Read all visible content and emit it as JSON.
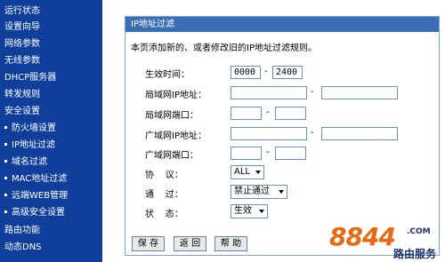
{
  "sidebar": {
    "items": [
      {
        "label": "运行状态",
        "sub": false
      },
      {
        "label": "设置向导",
        "sub": false
      },
      {
        "label": "网络参数",
        "sub": false
      },
      {
        "label": "无线参数",
        "sub": false
      },
      {
        "label": "DHCP服务器",
        "sub": false
      },
      {
        "label": "转发规则",
        "sub": false
      },
      {
        "label": "安全设置",
        "sub": false
      },
      {
        "label": "防火墙设置",
        "sub": true
      },
      {
        "label": "IP地址过滤",
        "sub": true
      },
      {
        "label": "域名过滤",
        "sub": true
      },
      {
        "label": "MAC地址过滤",
        "sub": true
      },
      {
        "label": "远端WEB管理",
        "sub": true
      },
      {
        "label": "高级安全设置",
        "sub": true
      },
      {
        "label": "路由功能",
        "sub": false
      },
      {
        "label": "动态DNS",
        "sub": false
      }
    ]
  },
  "panel": {
    "title": "IP地址过滤",
    "description": "本页添加新的、或者修改旧的IP地址过滤规则。"
  },
  "form": {
    "effective_time_label": "生效时间：",
    "time_start": "0000",
    "time_end": "2400",
    "lan_ip_label": "局域网IP地址：",
    "lan_ip_start": "",
    "lan_ip_end": "",
    "lan_port_label": "局域网端口：",
    "lan_port_start": "",
    "lan_port_end": "",
    "wan_ip_label": "广域网IP地址：",
    "wan_ip_start": "",
    "wan_ip_end": "",
    "wan_port_label": "广域网端口：",
    "wan_port_start": "",
    "wan_port_end": "",
    "protocol_label": "协    议：",
    "protocol_value": "ALL",
    "pass_label": "通    过：",
    "pass_value": "禁止通过",
    "status_label": "状    态：",
    "status_value": "生效",
    "dash": "-"
  },
  "buttons": {
    "save": "保 存",
    "back": "返 回",
    "help": "帮 助"
  },
  "watermark": {
    "number": "8844",
    "com": ".COM",
    "cn": "路由服务"
  },
  "colors": {
    "sidebar_bg": "#0f3f9a",
    "panel_title_bg": "#3a6fb8",
    "logo_orange": "#e56a12"
  }
}
